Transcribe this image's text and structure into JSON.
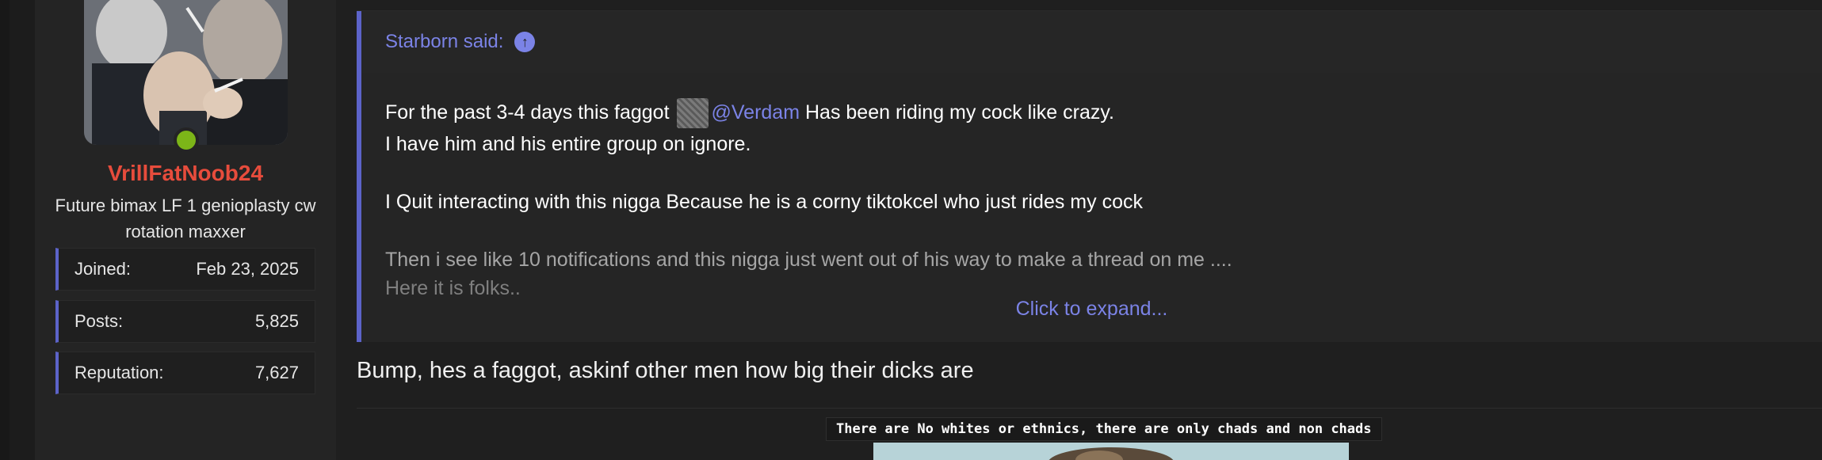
{
  "user": {
    "username": "VrillFatNoob24",
    "title": "Future bimax LF 1 genioplasty cw rotation maxxer",
    "online": true,
    "stats": [
      {
        "label": "Joined:",
        "value": "Feb 23, 2025"
      },
      {
        "label": "Posts:",
        "value": "5,825"
      },
      {
        "label": "Reputation:",
        "value": "7,627"
      }
    ]
  },
  "quote": {
    "author": "Starborn said:",
    "line1_before": "For the past 3-4 days this faggot",
    "mention": "@Verdam",
    "line1_after": "Has been riding my cock like crazy.",
    "line2": "I have him and his entire group on ignore.",
    "line3": "I Quit interacting with this nigga Because he is a corny tiktokcel who just rides my cock",
    "line4": "Then i see like 10 notifications and this nigga just went out of his way to make a thread on me ....",
    "line5": "Here it is folks..",
    "expand_label": "Click to expand..."
  },
  "reply": {
    "text": "Bump, hes a faggot, askinf other men how big their dicks are"
  },
  "signature": {
    "caption": "There are No whites or ethnics, there are only chads and non chads"
  },
  "icons": {
    "quote_jump": "arrow-up-circle-icon",
    "online": "online-status-dot"
  },
  "colors": {
    "accent": "#5c63c9",
    "link": "#7b83e6",
    "username": "#e74c3c",
    "online": "#7cb518",
    "background": "#1f1f1f"
  }
}
